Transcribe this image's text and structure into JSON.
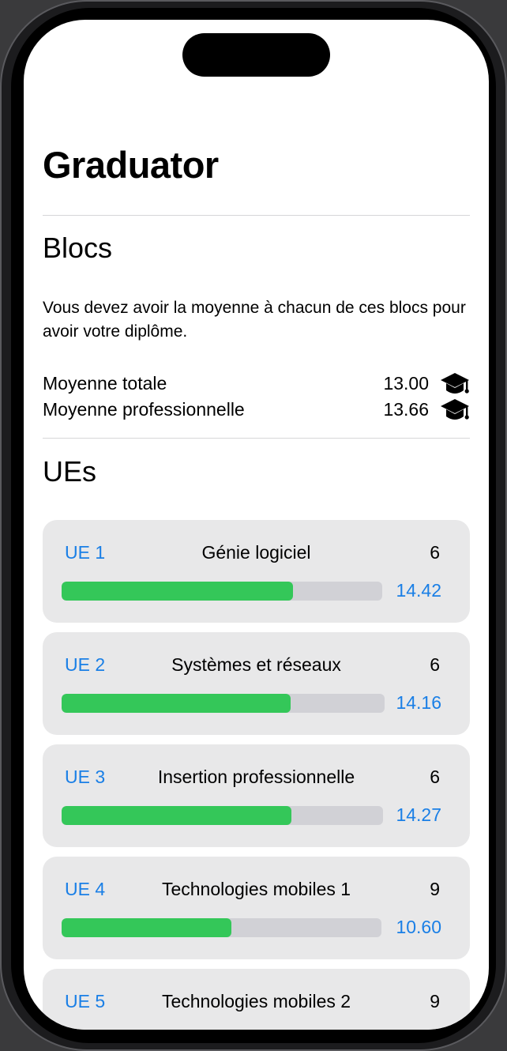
{
  "app": {
    "title": "Graduator"
  },
  "blocs": {
    "heading": "Blocs",
    "description": "Vous devez avoir la moyenne à chacun de ces blocs pour avoir votre diplôme.",
    "averages": [
      {
        "label": "Moyenne totale",
        "value": "13.00",
        "icon": "graduation-cap-icon"
      },
      {
        "label": "Moyenne professionnelle",
        "value": "13.66",
        "icon": "graduation-cap-icon"
      }
    ]
  },
  "ues": {
    "heading": "UEs",
    "max_grade": 20,
    "colors": {
      "accent": "#1a7fe6",
      "progress": "#34c759",
      "track": "#d1d1d6",
      "card": "#e8e8e9"
    },
    "items": [
      {
        "code": "UE 1",
        "name": "Génie logiciel",
        "credits": "6",
        "grade": "14.42",
        "progress": 0.721
      },
      {
        "code": "UE 2",
        "name": "Systèmes et réseaux",
        "credits": "6",
        "grade": "14.16",
        "progress": 0.708
      },
      {
        "code": "UE 3",
        "name": "Insertion professionnelle",
        "credits": "6",
        "grade": "14.27",
        "progress": 0.714
      },
      {
        "code": "UE 4",
        "name": "Technologies mobiles 1",
        "credits": "9",
        "grade": "10.60",
        "progress": 0.53
      },
      {
        "code": "UE 5",
        "name": "Technologies mobiles 2",
        "credits": "9",
        "grade": "",
        "progress": null
      }
    ]
  }
}
